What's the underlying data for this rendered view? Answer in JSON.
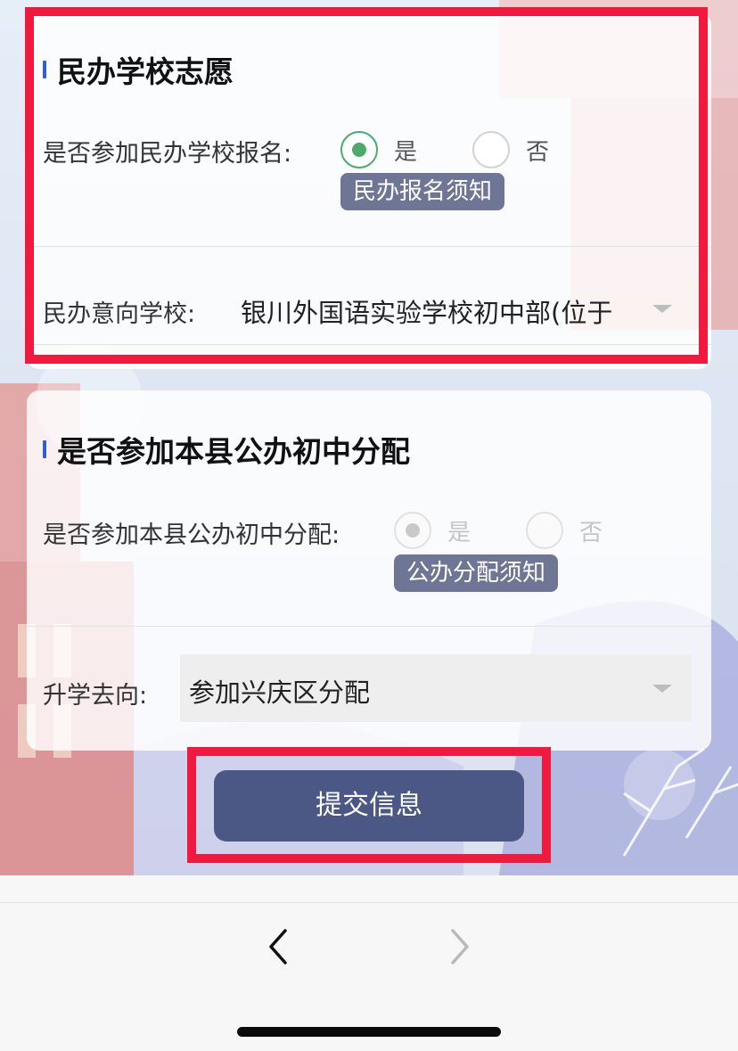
{
  "private_section": {
    "title": "民办学校志愿",
    "join_label": "是否参加民办学校报名:",
    "options": [
      "是",
      "否"
    ],
    "selected": "是",
    "notice_button": "民办报名须知",
    "school_label": "民办意向学校:",
    "school_value": "银川外国语实验学校初中部(位于"
  },
  "public_section": {
    "title": "是否参加本县公办初中分配",
    "join_label": "是否参加本县公办初中分配:",
    "options": [
      "是",
      "否"
    ],
    "selected": "是",
    "disabled": true,
    "notice_button": "公办分配须知",
    "direction_label": "升学去向:",
    "direction_value": "参加兴庆区分配"
  },
  "submit_label": "提交信息",
  "colors": {
    "highlight": "#f0193e",
    "submit": "#4b5886",
    "radio_checked": "#4caa6b",
    "pill": "#6f7594",
    "title_bar": "#2f5fd8"
  },
  "browser_nav": {
    "back_icon": "chevron-left-icon",
    "forward_icon": "chevron-right-icon",
    "forward_enabled": false
  }
}
